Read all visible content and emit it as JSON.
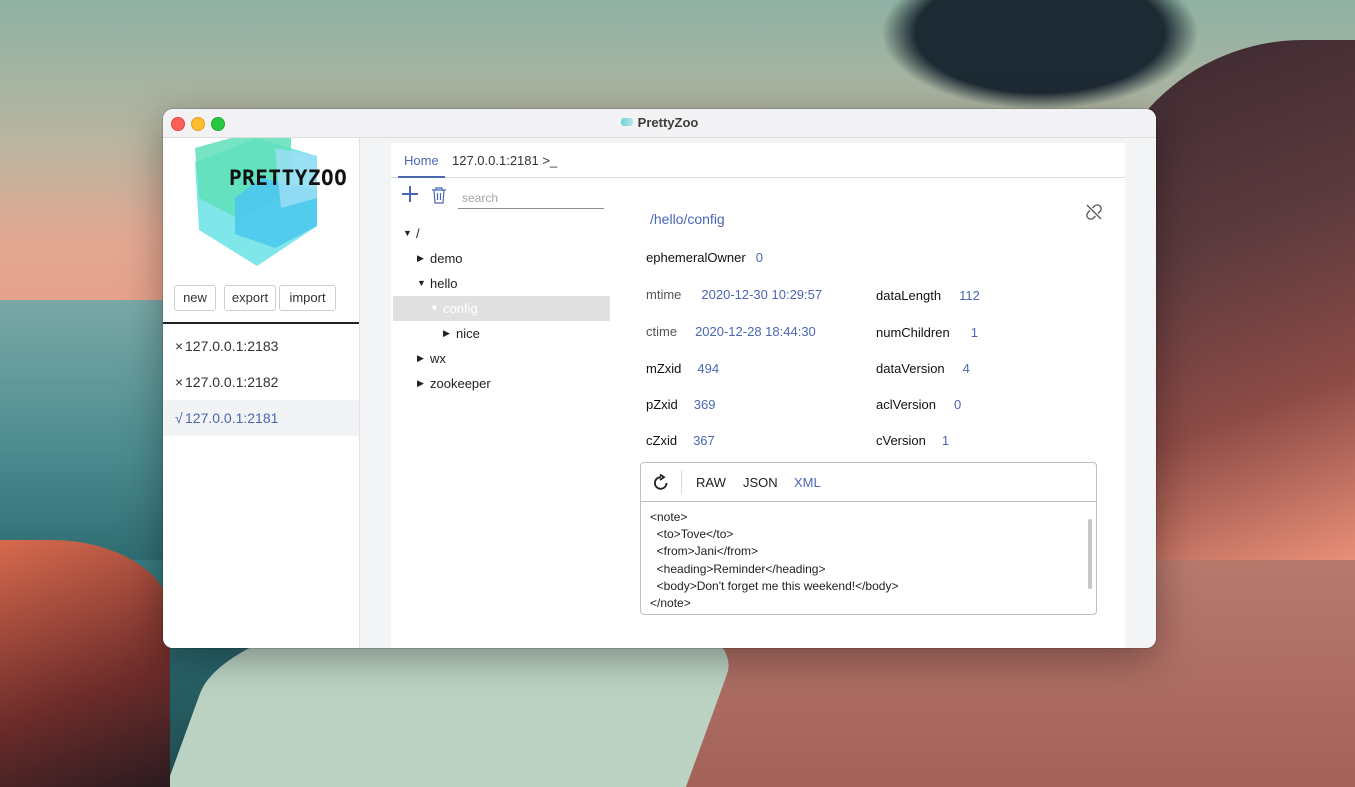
{
  "window": {
    "title": "PrettyZoo"
  },
  "logo": {
    "text": "PRETTYZOO"
  },
  "sidebar": {
    "buttons": {
      "new": "new",
      "export": "export",
      "import": "import"
    },
    "servers": [
      {
        "mark": "×",
        "address": "127.0.0.1:2183",
        "connected": false
      },
      {
        "mark": "×",
        "address": "127.0.0.1:2182",
        "connected": false
      },
      {
        "mark": "√",
        "address": "127.0.0.1:2181",
        "connected": true
      }
    ]
  },
  "tabs": {
    "home": "Home",
    "connection": "127.0.0.1:2181 >_"
  },
  "tree": {
    "search_placeholder": "search",
    "nodes": [
      {
        "label": "/",
        "expanded": true
      },
      {
        "label": "demo",
        "expanded": false
      },
      {
        "label": "hello",
        "expanded": true
      },
      {
        "label": "config",
        "expanded": true,
        "selected": true
      },
      {
        "label": "nice",
        "expanded": false
      },
      {
        "label": "wx",
        "expanded": false
      },
      {
        "label": "zookeeper",
        "expanded": false
      }
    ]
  },
  "detail": {
    "path": "/hello/config",
    "stats": {
      "ephemeralOwner": {
        "label": "ephemeralOwner",
        "value": "0"
      },
      "mtime": {
        "label": "mtime",
        "value": "2020-12-30 10:29:57"
      },
      "ctime": {
        "label": "ctime",
        "value": "2020-12-28 18:44:30"
      },
      "mZxid": {
        "label": "mZxid",
        "value": "494"
      },
      "pZxid": {
        "label": "pZxid",
        "value": "369"
      },
      "cZxid": {
        "label": "cZxid",
        "value": "367"
      },
      "dataLength": {
        "label": "dataLength",
        "value": "112"
      },
      "numChildren": {
        "label": "numChildren",
        "value": "1"
      },
      "dataVersion": {
        "label": "dataVersion",
        "value": "4"
      },
      "aclVersion": {
        "label": "aclVersion",
        "value": "0"
      },
      "cVersion": {
        "label": "cVersion",
        "value": "1"
      }
    },
    "formats": {
      "raw": "RAW",
      "json": "JSON",
      "xml": "XML",
      "active": "XML"
    },
    "content": "<note>\n  <to>Tove</to>\n  <from>Jani</from>\n  <heading>Reminder</heading>\n  <body>Don't forget me this weekend!</body>\n</note>"
  },
  "colors": {
    "accent": "#4a67b4",
    "selected_bg": "#e0e0e0"
  }
}
